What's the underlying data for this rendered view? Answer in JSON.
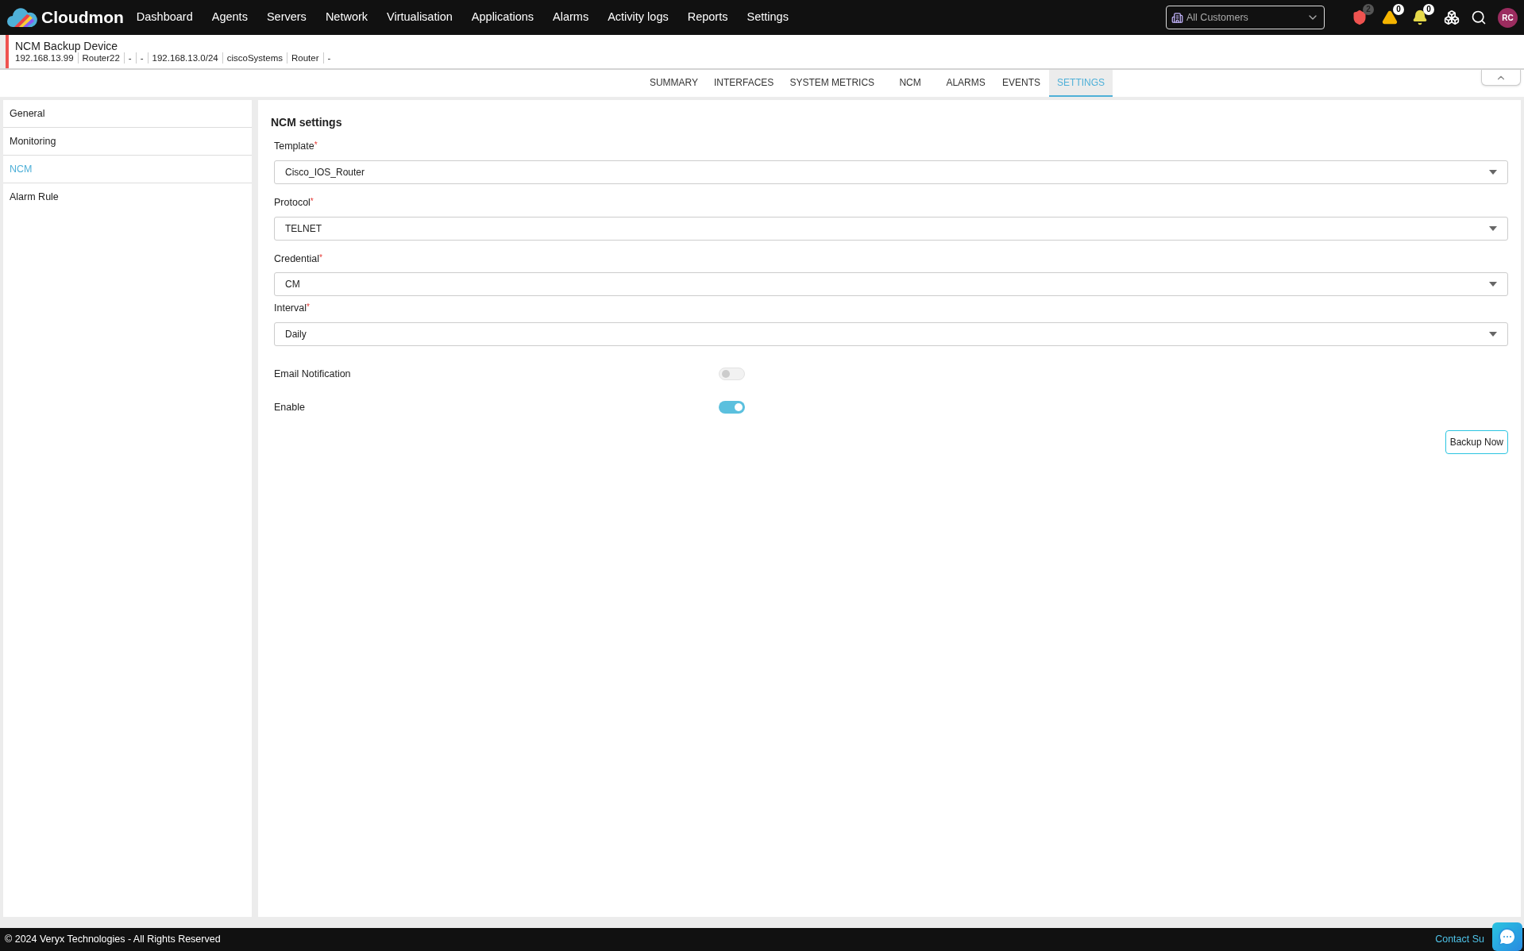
{
  "brand": "Cloudmon",
  "nav": [
    {
      "label": "Dashboard"
    },
    {
      "label": "Agents"
    },
    {
      "label": "Servers"
    },
    {
      "label": "Network"
    },
    {
      "label": "Virtualisation"
    },
    {
      "label": "Applications"
    },
    {
      "label": "Alarms"
    },
    {
      "label": "Activity logs"
    },
    {
      "label": "Reports"
    },
    {
      "label": "Settings"
    }
  ],
  "customer_select": {
    "value": "All Customers"
  },
  "indicators": [
    {
      "kind": "shield",
      "count": "2"
    },
    {
      "kind": "warning",
      "count": "0"
    },
    {
      "kind": "bell",
      "count": "0"
    }
  ],
  "avatar": "RC",
  "device": {
    "title": "NCM Backup Device",
    "details": [
      "192.168.13.99",
      "Router22",
      "-",
      "-",
      "192.168.13.0/24",
      "ciscoSystems",
      "Router",
      "-"
    ]
  },
  "tabs": [
    {
      "label": "SUMMARY",
      "selected": false
    },
    {
      "label": "INTERFACES",
      "selected": false
    },
    {
      "label": "SYSTEM METRICS",
      "selected": false
    },
    {
      "label": "NCM",
      "selected": false
    },
    {
      "label": "ALARMS",
      "selected": false
    },
    {
      "label": "EVENTS",
      "selected": false
    },
    {
      "label": "SETTINGS",
      "selected": true
    }
  ],
  "sidebar": {
    "items": [
      {
        "label": "General",
        "selected": false
      },
      {
        "label": "Monitoring",
        "selected": false
      },
      {
        "label": "NCM",
        "selected": true
      },
      {
        "label": "Alarm Rule",
        "selected": false
      }
    ]
  },
  "form": {
    "title": "NCM settings",
    "fields": [
      {
        "label": "Template",
        "required_mark": "*",
        "value": "Cisco_IOS_Router"
      },
      {
        "label": "Protocol",
        "required_mark": "*",
        "value": "TELNET"
      },
      {
        "label": "Credential",
        "required_mark": "*",
        "value": "CM"
      },
      {
        "label": "Interval",
        "required_mark": "*",
        "value": "Daily"
      }
    ],
    "toggles": [
      {
        "label": "Email Notification",
        "on": false
      },
      {
        "label": "Enable",
        "on": true
      }
    ],
    "button": "Backup Now"
  },
  "footer": {
    "copyright": "© 2024 Veryx Technologies - All Rights Reserved",
    "link": "Contact Su"
  }
}
